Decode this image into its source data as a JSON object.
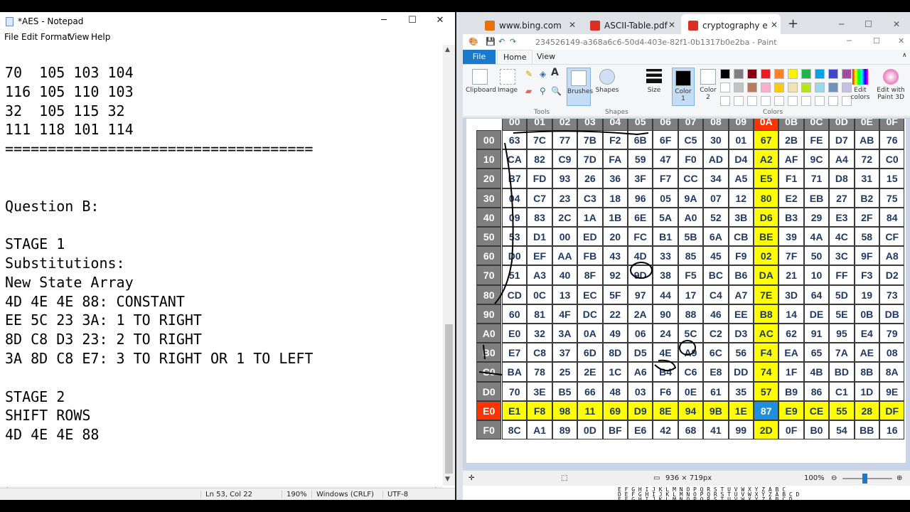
{
  "notepad": {
    "title": "*AES - Notepad",
    "controls": {
      "minimize": "─",
      "maximize": "☐",
      "close": "✕"
    },
    "menu": [
      "File",
      "Edit",
      "Format",
      "View",
      "Help"
    ],
    "content": "70  105 103 104\n116 105 110 103\n32  105 115 32\n111 118 101 114\n====================================\n\n\nQuestion B:\n\nSTAGE 1\nSubstitutions:\nNew State Array\n4D 4E 4E 88: CONSTANT\nEE 5C 23 3A: 1 TO RIGHT\n8D C8 D3 23: 2 TO RIGHT\n3A 8D C8 E7: 3 TO RIGHT OR 1 TO LEFT\n\nSTAGE 2\nSHIFT ROWS\n4D 4E 4E 88",
    "status": {
      "position": "Ln 53, Col 22",
      "zoom": "190%",
      "line_ending": "Windows (CRLF)",
      "encoding": "UTF-8"
    }
  },
  "browser": {
    "tabs": [
      {
        "label": "www.bing.com",
        "color": "#e8710a"
      },
      {
        "label": "ASCII-Table.pdf",
        "color": "#d93025"
      },
      {
        "label": "cryptography exam p",
        "color": "#d93025"
      }
    ],
    "new_tab": "+",
    "controls": {
      "minimize": "─",
      "maximize": "☐",
      "close": "✕"
    }
  },
  "paint": {
    "title": "234526149-a368a6c6-50d4-403e-82f1-0b1317b0e2ba - Paint",
    "tabs": {
      "file": "File",
      "home": "Home",
      "view": "View"
    },
    "ribbon": {
      "clipboard": "Clipboard",
      "image": "Image",
      "tools": "Tools",
      "brushes": "Brushes",
      "shapes": "Shapes",
      "shapes_group": "Shapes",
      "size": "Size",
      "color1": "Color\n1",
      "color2": "Color\n2",
      "colors": "Colors",
      "edit_colors": "Edit\ncolors",
      "edit_paint3d": "Edit with\nPaint 3D"
    },
    "palette": [
      "#000000",
      "#7f7f7f",
      "#880015",
      "#ed1c24",
      "#ff7f27",
      "#fff200",
      "#22b14c",
      "#00a2e8",
      "#3f48cc",
      "#a349a4",
      "#ffffff",
      "#c3c3c3",
      "#b97a57",
      "#ffaec9",
      "#ffc90e",
      "#efe4b0",
      "#b5e61d",
      "#99d9ea",
      "#7092be",
      "#c8bfe7"
    ],
    "status": {
      "dimensions": "936 × 719px",
      "zoom": "100%"
    },
    "bottom_strip": [
      "E F G H I J K L M N O P Q R S T U V W X Y Z A B C",
      "D E F G H I J K L M N O P Q R S T U V W X Y Z A B C D",
      "E F G H I J K L M N O P Q R S T U V W X Y Z A B C D"
    ]
  },
  "sbox": {
    "col_headers": [
      "00",
      "01",
      "02",
      "03",
      "04",
      "05",
      "06",
      "07",
      "08",
      "09",
      "0A",
      "0B",
      "0C",
      "0D",
      "0E",
      "0F"
    ],
    "row_headers": [
      "00",
      "10",
      "20",
      "30",
      "40",
      "50",
      "60",
      "70",
      "80",
      "90",
      "A0",
      "B0",
      "C0",
      "D0",
      "E0",
      "F0"
    ],
    "rows": [
      [
        "63",
        "7C",
        "77",
        "7B",
        "F2",
        "6B",
        "6F",
        "C5",
        "30",
        "01",
        "67",
        "2B",
        "FE",
        "D7",
        "AB",
        "76"
      ],
      [
        "CA",
        "82",
        "C9",
        "7D",
        "FA",
        "59",
        "47",
        "F0",
        "AD",
        "D4",
        "A2",
        "AF",
        "9C",
        "A4",
        "72",
        "C0"
      ],
      [
        "B7",
        "FD",
        "93",
        "26",
        "36",
        "3F",
        "F7",
        "CC",
        "34",
        "A5",
        "E5",
        "F1",
        "71",
        "D8",
        "31",
        "15"
      ],
      [
        "04",
        "C7",
        "23",
        "C3",
        "18",
        "96",
        "05",
        "9A",
        "07",
        "12",
        "80",
        "E2",
        "EB",
        "27",
        "B2",
        "75"
      ],
      [
        "09",
        "83",
        "2C",
        "1A",
        "1B",
        "6E",
        "5A",
        "A0",
        "52",
        "3B",
        "D6",
        "B3",
        "29",
        "E3",
        "2F",
        "84"
      ],
      [
        "53",
        "D1",
        "00",
        "ED",
        "20",
        "FC",
        "B1",
        "5B",
        "6A",
        "CB",
        "BE",
        "39",
        "4A",
        "4C",
        "58",
        "CF"
      ],
      [
        "D0",
        "EF",
        "AA",
        "FB",
        "43",
        "4D",
        "33",
        "85",
        "45",
        "F9",
        "02",
        "7F",
        "50",
        "3C",
        "9F",
        "A8"
      ],
      [
        "51",
        "A3",
        "40",
        "8F",
        "92",
        "9D",
        "38",
        "F5",
        "BC",
        "B6",
        "DA",
        "21",
        "10",
        "FF",
        "F3",
        "D2"
      ],
      [
        "CD",
        "0C",
        "13",
        "EC",
        "5F",
        "97",
        "44",
        "17",
        "C4",
        "A7",
        "7E",
        "3D",
        "64",
        "5D",
        "19",
        "73"
      ],
      [
        "60",
        "81",
        "4F",
        "DC",
        "22",
        "2A",
        "90",
        "88",
        "46",
        "EE",
        "B8",
        "14",
        "DE",
        "5E",
        "0B",
        "DB"
      ],
      [
        "E0",
        "32",
        "3A",
        "0A",
        "49",
        "06",
        "24",
        "5C",
        "C2",
        "D3",
        "AC",
        "62",
        "91",
        "95",
        "E4",
        "79"
      ],
      [
        "E7",
        "C8",
        "37",
        "6D",
        "8D",
        "D5",
        "4E",
        "A9",
        "6C",
        "56",
        "F4",
        "EA",
        "65",
        "7A",
        "AE",
        "08"
      ],
      [
        "BA",
        "78",
        "25",
        "2E",
        "1C",
        "A6",
        "B4",
        "C6",
        "E8",
        "DD",
        "74",
        "1F",
        "4B",
        "BD",
        "8B",
        "8A"
      ],
      [
        "70",
        "3E",
        "B5",
        "66",
        "48",
        "03",
        "F6",
        "0E",
        "61",
        "35",
        "57",
        "B9",
        "86",
        "C1",
        "1D",
        "9E"
      ],
      [
        "E1",
        "F8",
        "98",
        "11",
        "69",
        "D9",
        "8E",
        "94",
        "9B",
        "1E",
        "87",
        "E9",
        "CE",
        "55",
        "28",
        "DF"
      ],
      [
        "8C",
        "A1",
        "89",
        "0D",
        "BF",
        "E6",
        "42",
        "68",
        "41",
        "99",
        "2D",
        "0F",
        "B0",
        "54",
        "BB",
        "16"
      ]
    ],
    "highlight": {
      "header_col": "0A",
      "header_row": "E0",
      "intersection": "87",
      "colors": {
        "yellow": "#ffff00",
        "red": "#ff3300",
        "blue": "#1f8fe0",
        "header": "#7f7f7f"
      }
    }
  }
}
